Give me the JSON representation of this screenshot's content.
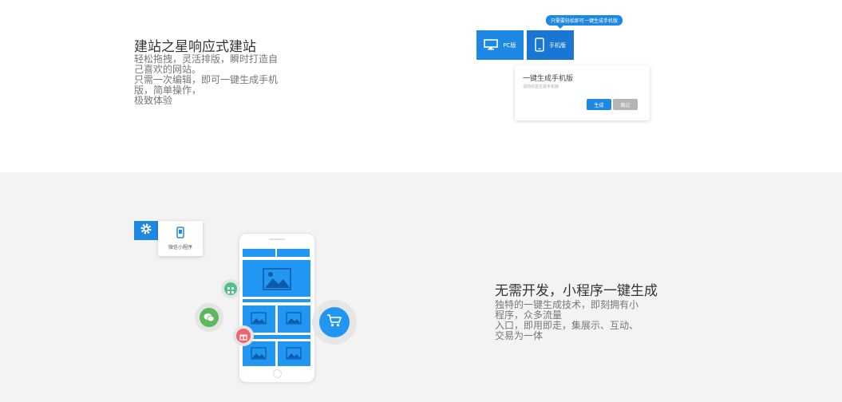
{
  "section1": {
    "title": "建站之星响应式建站",
    "desc_lines": [
      "轻松拖拽，灵活排版，瞬时打造自",
      "己喜欢的网站。",
      "只需一次编辑，即可一键生成手机",
      "版，简单操作，",
      "极致体验"
    ],
    "tooltip": "只需要轻松即可一键生成手机版",
    "pc_label": "PC版",
    "mobile_label": "手机版",
    "card_title": "一键生成手机版",
    "card_sub": "请前完善生成手机版",
    "generate_label": "生成",
    "skip_label": "跳过",
    "accent": "#1e88e5",
    "icons": [
      "monitor-icon",
      "mobile-icon"
    ]
  },
  "section2": {
    "title": "无需开发，小程序一键生成",
    "desc_lines": [
      "独特的一键生成技术，即刻拥有小",
      "程序，众多流量",
      "入口，即用即走，集展示、互动、",
      "交易为一体"
    ],
    "miniprogram_label": "微信小程序",
    "icons": [
      "gear-icon",
      "miniprogram-icon",
      "wechat-icon",
      "cart-icon",
      "gift-icon",
      "grid-icon"
    ],
    "colors": {
      "wechat": "#5cb85c",
      "mini": "#4fc08d",
      "gift": "#f06470",
      "blue": "#2196f3"
    }
  }
}
